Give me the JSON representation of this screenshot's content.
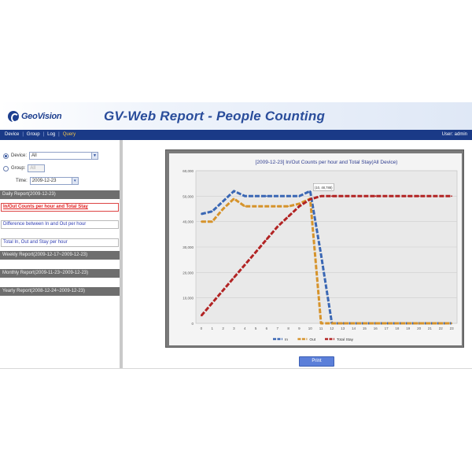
{
  "header": {
    "logo_text": "GeoVision",
    "title": "GV-Web Report - People Counting"
  },
  "nav": {
    "items": [
      "Device",
      "Group",
      "Log",
      "Query"
    ],
    "active_index": 3,
    "user": "User: admin"
  },
  "filters": {
    "device_label": "Device:",
    "device_value": "All",
    "group_label": "Group:",
    "group_value": "All",
    "time_label": "Time:",
    "time_value": "2009-12-23"
  },
  "reports": {
    "daily_header": "Daily Report(2009-12-23)",
    "daily_links": [
      "In/Out Counts per hour and Total Stay",
      "Difference between In and Out per hour",
      "Total In, Out and Stay per hour"
    ],
    "weekly_header": "Weekly Report(2009-12-17~2009-12-23)",
    "monthly_header": "Monthly Report(2009-11-23~2009-12-23)",
    "yearly_header": "Yearly Report(2008-12-24~2009-12-23)"
  },
  "print_label": "Print",
  "colors": {
    "in": "#3a67b4",
    "out": "#d6932b",
    "stay": "#b22424",
    "nav_bg": "#1a3a87"
  },
  "chart_data": {
    "type": "line",
    "title": "[2009-12-23] In/Out Counts per hour and Total Stay(All Device)",
    "x": [
      "0",
      "1",
      "2",
      "3",
      "4",
      "5",
      "6",
      "7",
      "8",
      "9",
      "10",
      "11",
      "12",
      "13",
      "14",
      "15",
      "16",
      "17",
      "18",
      "19",
      "20",
      "21",
      "22",
      "23"
    ],
    "ylim": [
      0,
      60000
    ],
    "yticks": [
      0,
      10000,
      20000,
      30000,
      40000,
      50000,
      60000
    ],
    "ytick_labels": [
      "0",
      "10,000",
      "20,000",
      "30,000",
      "40,000",
      "50,000",
      "60,000"
    ],
    "tooltip": "(10, 48,788)",
    "legend": "bottom",
    "series": [
      {
        "name": "In",
        "color": "#3a67b4",
        "values": [
          43000,
          44000,
          48000,
          52000,
          50000,
          50000,
          50000,
          50000,
          50000,
          50000,
          52000,
          27000,
          0,
          0,
          0,
          0,
          0,
          0,
          0,
          0,
          0,
          0,
          0,
          0
        ]
      },
      {
        "name": "Out",
        "color": "#d6932b",
        "values": [
          40000,
          40000,
          45000,
          49000,
          46000,
          46000,
          46000,
          46000,
          46000,
          47000,
          49000,
          0,
          0,
          0,
          0,
          0,
          0,
          0,
          0,
          0,
          0,
          0,
          0,
          0
        ]
      },
      {
        "name": "Total Stay",
        "color": "#b22424",
        "values": [
          3000,
          8000,
          13000,
          18000,
          23000,
          28000,
          33000,
          38000,
          42000,
          46000,
          48788,
          50000,
          50000,
          50000,
          50000,
          50000,
          50000,
          50000,
          50000,
          50000,
          50000,
          50000,
          50000,
          50000
        ]
      }
    ]
  }
}
